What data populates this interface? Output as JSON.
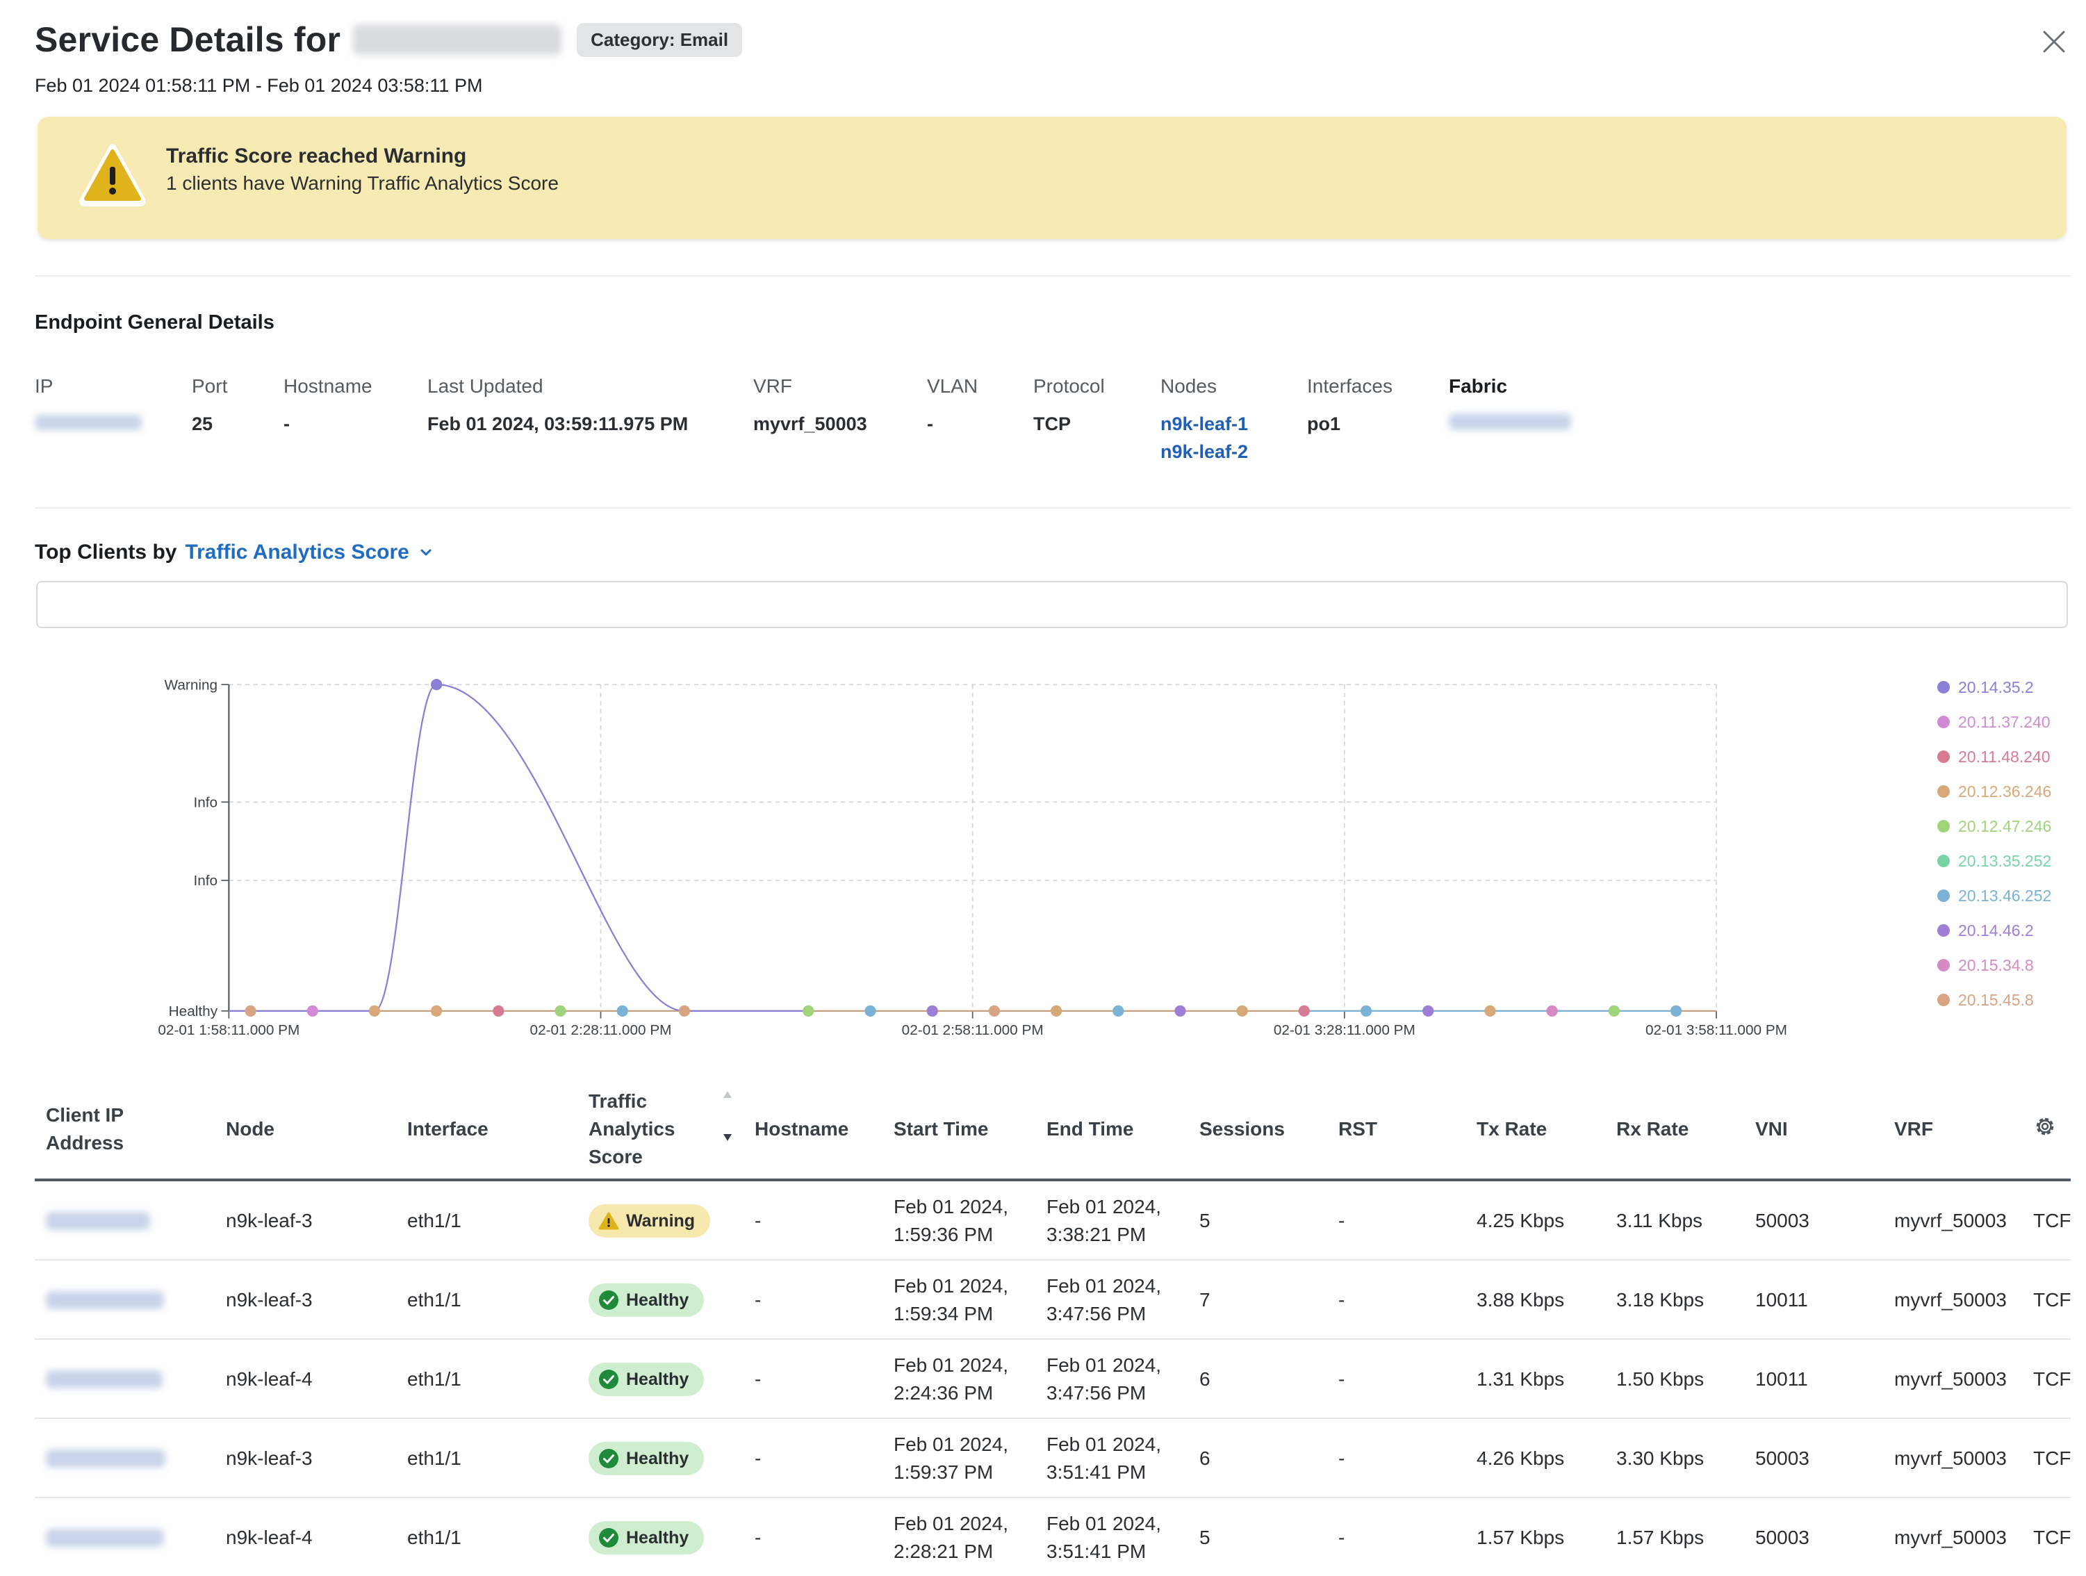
{
  "header": {
    "title": "Service Details for",
    "category_badge": "Category: Email",
    "date_range": "Feb 01 2024 01:58:11 PM - Feb 01 2024 03:58:11 PM"
  },
  "alert": {
    "title": "Traffic Score reached Warning",
    "message": "1 clients have Warning Traffic Analytics Score"
  },
  "endpoint": {
    "section_title": "Endpoint General Details",
    "labels": {
      "ip": "IP",
      "port": "Port",
      "hostname": "Hostname",
      "last_updated": "Last Updated",
      "vrf": "VRF",
      "vlan": "VLAN",
      "protocol": "Protocol",
      "nodes": "Nodes",
      "interfaces": "Interfaces",
      "fabric": "Fabric"
    },
    "values": {
      "port": "25",
      "hostname": "-",
      "last_updated": "Feb 01 2024, 03:59:11.975 PM",
      "vrf": "myvrf_50003",
      "vlan": "-",
      "protocol": "TCP",
      "node_1": "n9k-leaf-1",
      "node_2": "n9k-leaf-2",
      "interfaces": "po1"
    }
  },
  "top_clients": {
    "label": "Top Clients by",
    "metric": "Traffic Analytics Score"
  },
  "chart_data": {
    "type": "line",
    "y_categories": [
      "Healthy",
      "Info",
      "Info",
      "Warning"
    ],
    "y_levels": [
      0,
      1,
      1.6,
      2.5
    ],
    "x_tick_labels": [
      "02-01 1:58:11.000 PM",
      "02-01 2:28:11.000 PM",
      "02-01 2:58:11.000 PM",
      "02-01 3:28:11.000 PM",
      "02-01 3:58:11.000 PM"
    ],
    "x_range_minutes": [
      0,
      120
    ],
    "grid": true,
    "legend_position": "right",
    "series": [
      {
        "name": "20.14.35.2",
        "color": "#8a7fd6",
        "peak": {
          "x": 16.75,
          "y": 2.5
        }
      },
      {
        "name": "20.11.37.240",
        "color": "#d38ad6"
      },
      {
        "name": "20.11.48.240",
        "color": "#d77a94"
      },
      {
        "name": "20.12.36.246",
        "color": "#d8a978"
      },
      {
        "name": "20.12.47.246",
        "color": "#9fd47a"
      },
      {
        "name": "20.13.35.252",
        "color": "#78d4a6"
      },
      {
        "name": "20.13.46.252",
        "color": "#7ab3d6"
      },
      {
        "name": "20.14.46.2",
        "color": "#9f7fd6"
      },
      {
        "name": "20.15.34.8",
        "color": "#d68ac4"
      },
      {
        "name": "20.15.45.8",
        "color": "#d8a484"
      }
    ],
    "marker_positions_minutes": [
      1.75,
      6.75,
      11.75,
      16.75,
      21.75,
      26.75,
      31.75,
      36.75,
      46.75,
      51.75,
      56.75,
      61.75,
      66.75,
      71.75,
      76.75,
      81.75,
      86.75,
      91.75,
      96.75,
      101.75,
      106.75,
      111.75,
      116.75
    ],
    "marker_series_order": [
      9,
      1,
      3,
      3,
      2,
      4,
      6,
      9,
      4,
      6,
      7,
      9,
      3,
      6,
      7,
      3,
      2,
      6,
      7,
      3,
      8,
      4,
      6
    ]
  },
  "table": {
    "headers": {
      "client_ip": "Client IP Address",
      "node": "Node",
      "interface": "Interface",
      "score": "Traffic Analytics Score",
      "hostname": "Hostname",
      "start_time": "Start Time",
      "end_time": "End Time",
      "sessions": "Sessions",
      "rst": "RST",
      "tx_rate": "Tx Rate",
      "rx_rate": "Rx Rate",
      "vni": "VNI",
      "vrf": "VRF"
    },
    "rows": [
      {
        "node": "n9k-leaf-3",
        "interface": "eth1/1",
        "score": "Warning",
        "hostname": "-",
        "start_1": "Feb 01 2024,",
        "start_2": "1:59:36 PM",
        "end_1": "Feb 01 2024,",
        "end_2": "3:38:21 PM",
        "sessions": "5",
        "rst": "-",
        "tx": "4.25 Kbps",
        "rx": "3.11 Kbps",
        "vni": "50003",
        "vrf": "myvrf_50003",
        "proto": "TCF"
      },
      {
        "node": "n9k-leaf-3",
        "interface": "eth1/1",
        "score": "Healthy",
        "hostname": "-",
        "start_1": "Feb 01 2024,",
        "start_2": "1:59:34 PM",
        "end_1": "Feb 01 2024,",
        "end_2": "3:47:56 PM",
        "sessions": "7",
        "rst": "-",
        "tx": "3.88 Kbps",
        "rx": "3.18 Kbps",
        "vni": "10011",
        "vrf": "myvrf_50003",
        "proto": "TCF"
      },
      {
        "node": "n9k-leaf-4",
        "interface": "eth1/1",
        "score": "Healthy",
        "hostname": "-",
        "start_1": "Feb 01 2024,",
        "start_2": "2:24:36 PM",
        "end_1": "Feb 01 2024,",
        "end_2": "3:47:56 PM",
        "sessions": "6",
        "rst": "-",
        "tx": "1.31 Kbps",
        "rx": "1.50 Kbps",
        "vni": "10011",
        "vrf": "myvrf_50003",
        "proto": "TCF"
      },
      {
        "node": "n9k-leaf-3",
        "interface": "eth1/1",
        "score": "Healthy",
        "hostname": "-",
        "start_1": "Feb 01 2024,",
        "start_2": "1:59:37 PM",
        "end_1": "Feb 01 2024,",
        "end_2": "3:51:41 PM",
        "sessions": "6",
        "rst": "-",
        "tx": "4.26 Kbps",
        "rx": "3.30 Kbps",
        "vni": "50003",
        "vrf": "myvrf_50003",
        "proto": "TCF"
      },
      {
        "node": "n9k-leaf-4",
        "interface": "eth1/1",
        "score": "Healthy",
        "hostname": "-",
        "start_1": "Feb 01 2024,",
        "start_2": "2:28:21 PM",
        "end_1": "Feb 01 2024,",
        "end_2": "3:51:41 PM",
        "sessions": "5",
        "rst": "-",
        "tx": "1.57 Kbps",
        "rx": "1.57 Kbps",
        "vni": "50003",
        "vrf": "myvrf_50003",
        "proto": "TCF"
      }
    ]
  },
  "icons": {
    "close": "close-icon",
    "alert": "warning-triangle-icon",
    "dropdown": "chevron-down-icon",
    "settings": "gear-icon",
    "healthy": "check-circle-icon",
    "warning": "warning-triangle-icon"
  },
  "colors": {
    "alert_bg": "#f7ebb3",
    "link": "#1f6cc4",
    "warning_badge": "#f7e8ad",
    "healthy_badge": "#cfeecf",
    "healthy_icon": "#1e8a3a",
    "warning_icon": "#e0b21c"
  }
}
